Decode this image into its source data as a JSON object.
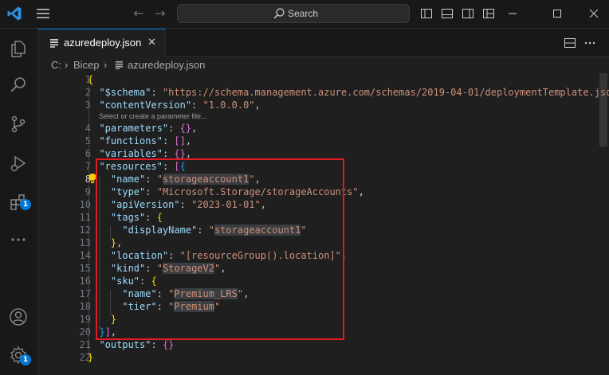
{
  "titlebar": {
    "search_label": "Search"
  },
  "activity_bar": {
    "extensions_badge": "1",
    "manage_badge": "1"
  },
  "tab": {
    "label": "azuredeploy.json",
    "close_glyph": "✕"
  },
  "breadcrumb": {
    "drive": "C:",
    "sep1": "›",
    "folder": "Bicep",
    "sep2": "›",
    "file": "azuredeploy.json"
  },
  "editor": {
    "codelens": "Select or create a parameter file...",
    "line_numbers": [
      "1",
      "2",
      "3",
      "4",
      "5",
      "6",
      "7",
      "8",
      "9",
      "10",
      "11",
      "12",
      "13",
      "14",
      "15",
      "16",
      "17",
      "18",
      "19",
      "20",
      "21",
      "22"
    ],
    "schema_key": "\"$schema\"",
    "schema_val": "\"https://schema.management.azure.com/schemas/2019-04-01/deploymentTemplate.json#\"",
    "contentVersion_key": "\"contentVersion\"",
    "contentVersion_val": "\"1.0.0.0\"",
    "parameters_key": "\"parameters\"",
    "functions_key": "\"functions\"",
    "variables_key": "\"variables\"",
    "resources_key": "\"resources\"",
    "name_key": "\"name\"",
    "name_val": "storageaccount1",
    "type_key": "\"type\"",
    "type_val": "\"Microsoft.Storage/storageAccounts\"",
    "apiVersion_key": "\"apiVersion\"",
    "apiVersion_val": "\"2023-01-01\"",
    "tags_key": "\"tags\"",
    "displayName_key": "\"displayName\"",
    "displayName_val": "storageaccount1",
    "location_key": "\"location\"",
    "location_val": "\"[resourceGroup().location]\"",
    "kind_key": "\"kind\"",
    "kind_val": "StorageV2",
    "sku_key": "\"sku\"",
    "sku_name_key": "\"name\"",
    "sku_name_val": "Premium_LRS",
    "sku_tier_key": "\"tier\"",
    "sku_tier_val": "Premium",
    "outputs_key": "\"outputs\""
  },
  "colors": {
    "accent": "#0078d4",
    "highlight_box": "#e01b24",
    "string": "#ce9178",
    "key": "#9cdcfe"
  }
}
